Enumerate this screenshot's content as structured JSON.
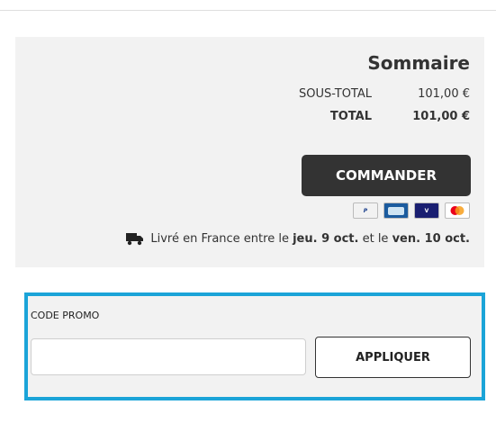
{
  "summary": {
    "title": "Sommaire",
    "subtotal_label": "SOUS-TOTAL",
    "subtotal_value": "101,00 €",
    "total_label": "TOTAL",
    "total_value": "101,00 €",
    "checkout_label": "COMMANDER",
    "payment_icons": [
      "paypal-icon",
      "carte-bancaire-icon",
      "visa-icon",
      "mastercard-icon"
    ],
    "delivery": {
      "prefix": "Livré en France entre le",
      "date_start": "jeu. 9 oct.",
      "middle": "et le",
      "date_end": "ven. 10 oct."
    }
  },
  "promo": {
    "label": "CODE PROMO",
    "input_value": "",
    "apply_label": "APPLIQUER"
  },
  "colors": {
    "panel_bg": "#f2f2f2",
    "checkout_bg": "#333333",
    "highlight_border": "#1ba4d8"
  }
}
